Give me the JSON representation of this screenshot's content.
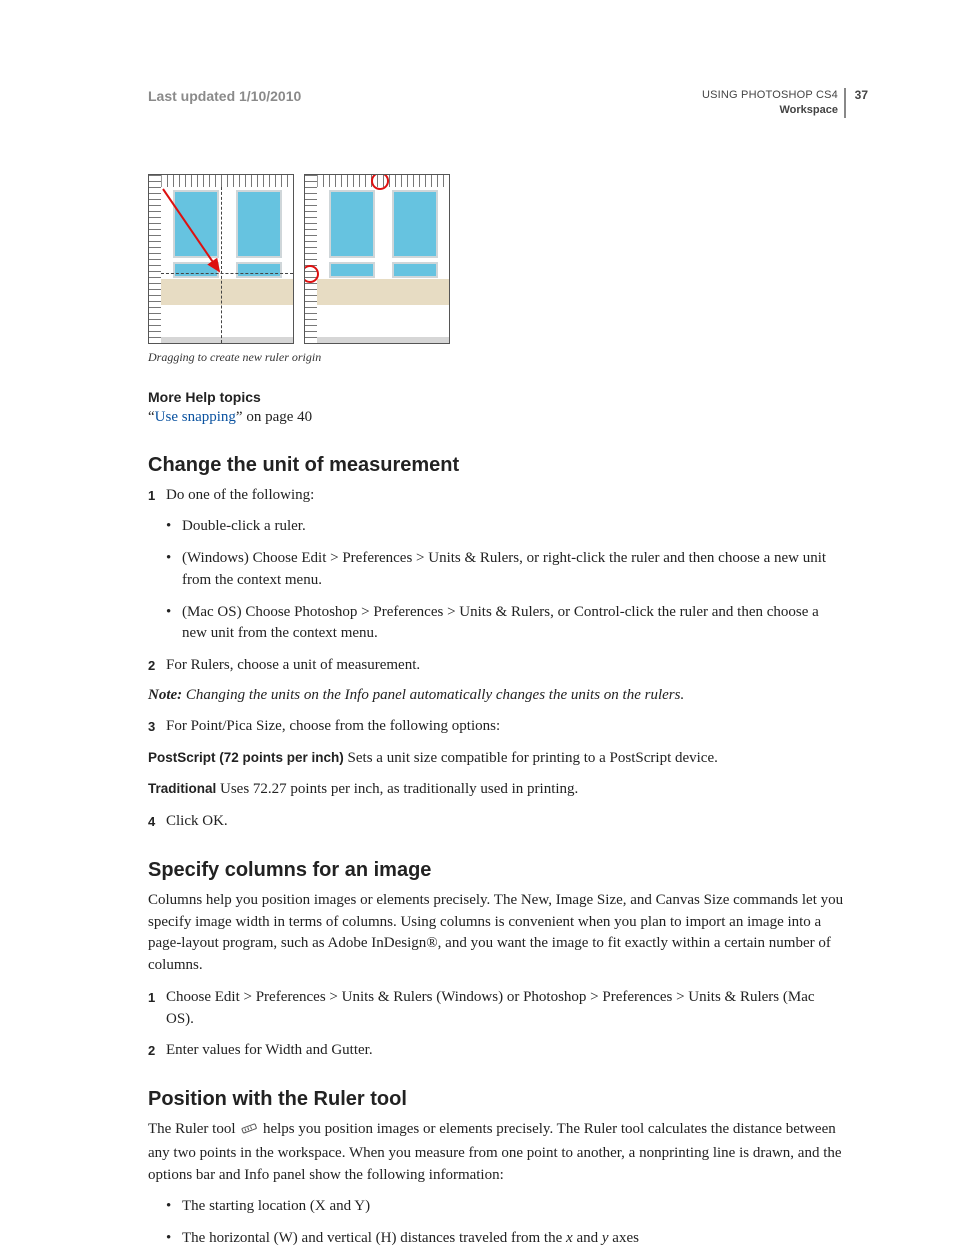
{
  "header": {
    "last_updated": "Last updated 1/10/2010",
    "book": "USING PHOTOSHOP CS4",
    "section": "Workspace",
    "page_number": "37"
  },
  "figure": {
    "caption": "Dragging to create new ruler origin"
  },
  "more_help": {
    "heading": "More Help topics",
    "quote_open": "“",
    "link_text": "Use snapping",
    "quote_close_text": "” on page 40"
  },
  "sect1": {
    "heading": "Change the unit of measurement",
    "step1": "Do one of the following:",
    "b1": "Double-click a ruler.",
    "b2": "(Windows) Choose Edit > Preferences > Units & Rulers, or right-click the ruler and then choose a new unit from the context menu.",
    "b3": "(Mac OS) Choose Photoshop > Preferences > Units & Rulers, or Control-click the ruler and then choose a new unit from the context menu.",
    "step2": "For Rulers, choose a unit of measurement.",
    "note_label": "Note:",
    "note_text": " Changing the units on the Info panel automatically changes the units on the rulers.",
    "step3": "For Point/Pica Size, choose from the following options:",
    "term1_label": "PostScript (72 points per inch)",
    "term1_desc": "  Sets a unit size compatible for printing to a PostScript device.",
    "term2_label": "Traditional",
    "term2_desc": "  Uses 72.27 points per inch, as traditionally used in printing.",
    "step4": "Click OK."
  },
  "sect2": {
    "heading": "Specify columns for an image",
    "para": "Columns help you position images or elements precisely. The New, Image Size, and Canvas Size commands let you specify image width in terms of columns. Using columns is convenient when you plan to import an image into a page-layout program, such as Adobe InDesign®, and you want the image to fit exactly within a certain number of columns.",
    "step1": "Choose Edit > Preferences > Units & Rulers (Windows) or Photoshop > Preferences > Units & Rulers (Mac OS).",
    "step2": "Enter values for Width and Gutter."
  },
  "sect3": {
    "heading": "Position with the Ruler tool",
    "para_a": "The Ruler tool ",
    "para_b": " helps you position images or elements precisely. The Ruler tool calculates the distance between any two points in the workspace. When you measure from one point to another, a nonprinting line is drawn, and the options bar and Info panel show the following information:",
    "b1": "The starting location (X and Y)",
    "b2_a": "The horizontal (W) and vertical (H) distances traveled from the ",
    "b2_x": "x",
    "b2_mid": " and ",
    "b2_y": "y",
    "b2_end": " axes"
  },
  "nums": {
    "n1": "1",
    "n2": "2",
    "n3": "3",
    "n4": "4"
  }
}
